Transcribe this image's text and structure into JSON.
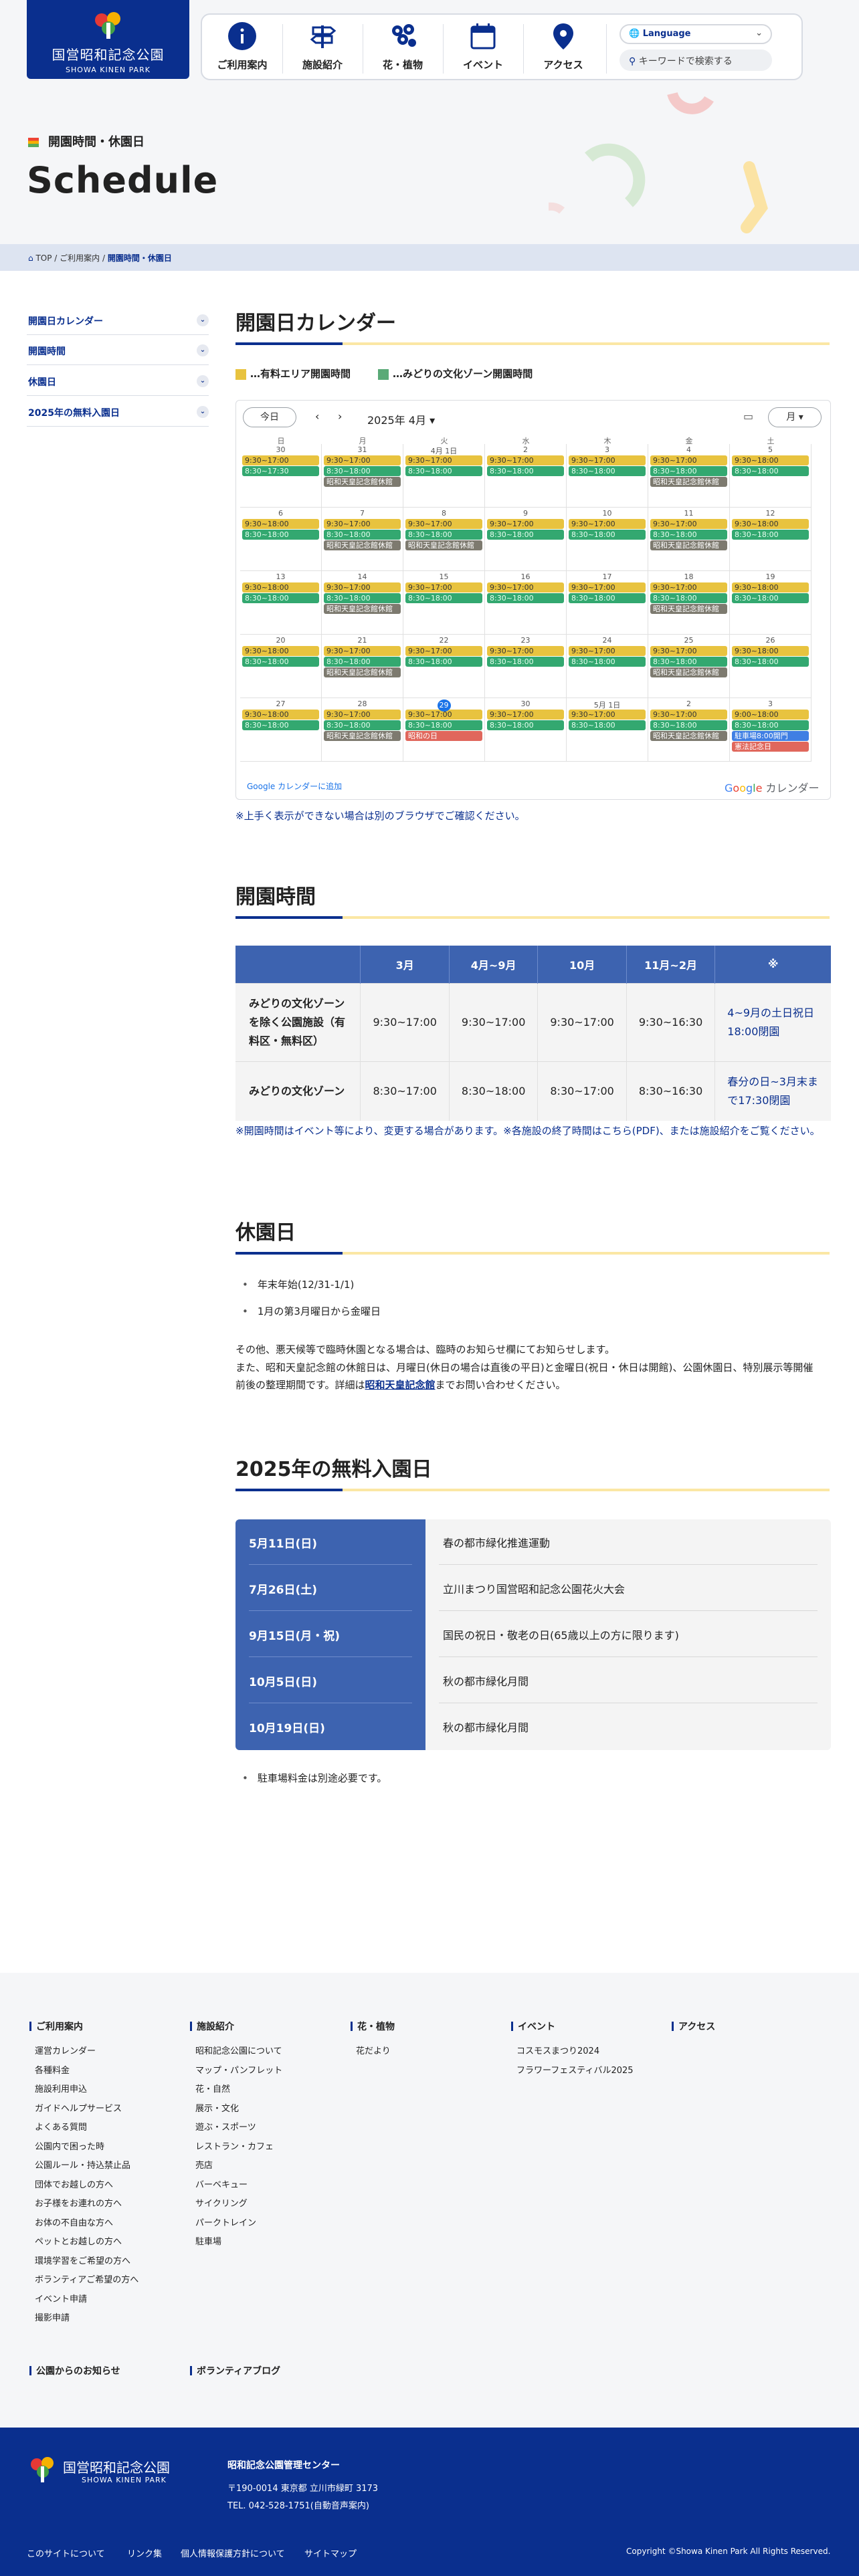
{
  "header": {
    "logo_ja": "国営昭和記念公園",
    "logo_en": "SHOWA KINEN PARK",
    "nav": [
      {
        "label": "ご利用案内",
        "icon": "info-icon"
      },
      {
        "label": "施設紹介",
        "icon": "signpost-icon"
      },
      {
        "label": "花・植物",
        "icon": "flower-icon"
      },
      {
        "label": "イベント",
        "icon": "calendar-icon"
      },
      {
        "label": "アクセス",
        "icon": "map-pin-icon"
      }
    ],
    "language": "Language",
    "search_placeholder": "キーワードで検索する"
  },
  "hero": {
    "subtitle": "開園時間・休園日",
    "title": "Schedule"
  },
  "breadcrumb": [
    "TOP",
    "ご利用案内",
    "開園時間・休園日"
  ],
  "sidebar": [
    "開園日カレンダー",
    "開園時間",
    "休園日",
    "2025年の無料入園日"
  ],
  "calendar": {
    "heading": "開園日カレンダー",
    "legend_yellow": "…有料エリア開園時間",
    "legend_green": "…みどりの文化ゾーン開園時間",
    "today_btn": "今日",
    "month_label": "2025年 4月",
    "view_btn": "月",
    "days": [
      "日",
      "月",
      "火",
      "水",
      "木",
      "金",
      "土"
    ],
    "add_link": "Google カレンダーに追加",
    "google_text": "カレンダー",
    "weeks": [
      [
        {
          "d": "30",
          "ev": [
            [
              "y",
              "9:30~17:00"
            ],
            [
              "g",
              "8:30~17:30"
            ]
          ]
        },
        {
          "d": "31",
          "ev": [
            [
              "y",
              "9:30~17:00"
            ],
            [
              "g",
              "8:30~18:00"
            ],
            [
              "k",
              "昭和天皇記念館休館"
            ]
          ]
        },
        {
          "d": "4月 1日",
          "ev": [
            [
              "y",
              "9:30~17:00"
            ],
            [
              "g",
              "8:30~18:00"
            ]
          ]
        },
        {
          "d": "2",
          "ev": [
            [
              "y",
              "9:30~17:00"
            ],
            [
              "g",
              "8:30~18:00"
            ]
          ]
        },
        {
          "d": "3",
          "ev": [
            [
              "y",
              "9:30~17:00"
            ],
            [
              "g",
              "8:30~18:00"
            ]
          ]
        },
        {
          "d": "4",
          "ev": [
            [
              "y",
              "9:30~17:00"
            ],
            [
              "g",
              "8:30~18:00"
            ],
            [
              "k",
              "昭和天皇記念館休館"
            ]
          ]
        },
        {
          "d": "5",
          "ev": [
            [
              "y",
              "9:30~18:00"
            ],
            [
              "g",
              "8:30~18:00"
            ]
          ]
        }
      ],
      [
        {
          "d": "6",
          "ev": [
            [
              "y",
              "9:30~18:00"
            ],
            [
              "g",
              "8:30~18:00"
            ]
          ]
        },
        {
          "d": "7",
          "ev": [
            [
              "y",
              "9:30~17:00"
            ],
            [
              "g",
              "8:30~18:00"
            ],
            [
              "k",
              "昭和天皇記念館休館"
            ]
          ]
        },
        {
          "d": "8",
          "ev": [
            [
              "y",
              "9:30~17:00"
            ],
            [
              "g",
              "8:30~18:00"
            ],
            [
              "k",
              "昭和天皇記念館休館"
            ]
          ]
        },
        {
          "d": "9",
          "ev": [
            [
              "y",
              "9:30~17:00"
            ],
            [
              "g",
              "8:30~18:00"
            ]
          ]
        },
        {
          "d": "10",
          "ev": [
            [
              "y",
              "9:30~17:00"
            ],
            [
              "g",
              "8:30~18:00"
            ]
          ]
        },
        {
          "d": "11",
          "ev": [
            [
              "y",
              "9:30~17:00"
            ],
            [
              "g",
              "8:30~18:00"
            ],
            [
              "k",
              "昭和天皇記念館休館"
            ]
          ]
        },
        {
          "d": "12",
          "ev": [
            [
              "y",
              "9:30~18:00"
            ],
            [
              "g",
              "8:30~18:00"
            ]
          ]
        }
      ],
      [
        {
          "d": "13",
          "ev": [
            [
              "y",
              "9:30~18:00"
            ],
            [
              "g",
              "8:30~18:00"
            ]
          ]
        },
        {
          "d": "14",
          "ev": [
            [
              "y",
              "9:30~17:00"
            ],
            [
              "g",
              "8:30~18:00"
            ],
            [
              "k",
              "昭和天皇記念館休館"
            ]
          ]
        },
        {
          "d": "15",
          "ev": [
            [
              "y",
              "9:30~17:00"
            ],
            [
              "g",
              "8:30~18:00"
            ]
          ]
        },
        {
          "d": "16",
          "ev": [
            [
              "y",
              "9:30~17:00"
            ],
            [
              "g",
              "8:30~18:00"
            ]
          ]
        },
        {
          "d": "17",
          "ev": [
            [
              "y",
              "9:30~17:00"
            ],
            [
              "g",
              "8:30~18:00"
            ]
          ]
        },
        {
          "d": "18",
          "ev": [
            [
              "y",
              "9:30~17:00"
            ],
            [
              "g",
              "8:30~18:00"
            ],
            [
              "k",
              "昭和天皇記念館休館"
            ]
          ]
        },
        {
          "d": "19",
          "ev": [
            [
              "y",
              "9:30~18:00"
            ],
            [
              "g",
              "8:30~18:00"
            ]
          ]
        }
      ],
      [
        {
          "d": "20",
          "ev": [
            [
              "y",
              "9:30~18:00"
            ],
            [
              "g",
              "8:30~18:00"
            ]
          ]
        },
        {
          "d": "21",
          "ev": [
            [
              "y",
              "9:30~17:00"
            ],
            [
              "g",
              "8:30~18:00"
            ],
            [
              "k",
              "昭和天皇記念館休館"
            ]
          ]
        },
        {
          "d": "22",
          "ev": [
            [
              "y",
              "9:30~17:00"
            ],
            [
              "g",
              "8:30~18:00"
            ]
          ]
        },
        {
          "d": "23",
          "ev": [
            [
              "y",
              "9:30~17:00"
            ],
            [
              "g",
              "8:30~18:00"
            ]
          ]
        },
        {
          "d": "24",
          "ev": [
            [
              "y",
              "9:30~17:00"
            ],
            [
              "g",
              "8:30~18:00"
            ]
          ]
        },
        {
          "d": "25",
          "ev": [
            [
              "y",
              "9:30~17:00"
            ],
            [
              "g",
              "8:30~18:00"
            ],
            [
              "k",
              "昭和天皇記念館休館"
            ]
          ]
        },
        {
          "d": "26",
          "ev": [
            [
              "y",
              "9:30~18:00"
            ],
            [
              "g",
              "8:30~18:00"
            ]
          ]
        }
      ],
      [
        {
          "d": "27",
          "ev": [
            [
              "y",
              "9:30~18:00"
            ],
            [
              "g",
              "8:30~18:00"
            ]
          ]
        },
        {
          "d": "28",
          "ev": [
            [
              "y",
              "9:30~17:00"
            ],
            [
              "g",
              "8:30~18:00"
            ],
            [
              "k",
              "昭和天皇記念館休館"
            ]
          ]
        },
        {
          "d": "29",
          "today": true,
          "ev": [
            [
              "y",
              "9:30~17:00"
            ],
            [
              "g",
              "8:30~18:00"
            ],
            [
              "r",
              "昭和の日"
            ]
          ]
        },
        {
          "d": "30",
          "ev": [
            [
              "y",
              "9:30~17:00"
            ],
            [
              "g",
              "8:30~18:00"
            ]
          ]
        },
        {
          "d": "5月 1日",
          "ev": [
            [
              "y",
              "9:30~17:00"
            ],
            [
              "g",
              "8:30~18:00"
            ]
          ]
        },
        {
          "d": "2",
          "ev": [
            [
              "y",
              "9:30~17:00"
            ],
            [
              "g",
              "8:30~18:00"
            ],
            [
              "k",
              "昭和天皇記念館休館"
            ]
          ]
        },
        {
          "d": "3",
          "ev": [
            [
              "y",
              "9:00~18:00"
            ],
            [
              "g",
              "8:30~18:00"
            ],
            [
              "b",
              "駐車場8:00開門"
            ],
            [
              "r",
              "憲法記念日"
            ]
          ]
        }
      ]
    ],
    "note": "※上手く表示ができない場合は別のブラウザでご確認ください。"
  },
  "hours": {
    "heading": "開園時間",
    "headers": [
      "",
      "3月",
      "4月~9月",
      "10月",
      "11月~2月",
      "※"
    ],
    "rows": [
      [
        "みどりの文化ゾーンを除く公園施設（有料区・無料区）",
        "9:30~17:00",
        "9:30~17:00",
        "9:30~17:00",
        "9:30~16:30",
        "4~9月の土日祝日18:00閉園"
      ],
      [
        "みどりの文化ゾーン",
        "8:30~17:00",
        "8:30~18:00",
        "8:30~17:00",
        "8:30~16:30",
        "春分の日~3月末まで17:30閉園"
      ]
    ],
    "note": "※開園時間はイベント等により、変更する場合があります。※各施設の終了時間はこちら(PDF)、または施設紹介をご覧ください。"
  },
  "closed": {
    "heading": "休園日",
    "items": [
      "年末年始(12/31-1/1)",
      "1月の第3月曜日から金曜日"
    ],
    "p1": "その他、悪天候等で臨時休園となる場合は、臨時のお知らせ欄にてお知らせします。",
    "p2a": "また、昭和天皇記念館の休館日は、月曜日(休日の場合は直後の平日)と金曜日(祝日・休日は開館)、公園休園日、特別展示等開催",
    "p2b": "前後の整理期間です。詳細は",
    "p2link": "昭和天皇記念館",
    "p2c": "までお問い合わせください。"
  },
  "free": {
    "heading": "2025年の無料入園日",
    "rows": [
      [
        "5月11日(日)",
        "春の都市緑化推進運動"
      ],
      [
        "7月26日(土)",
        "立川まつり国営昭和記念公園花火大会"
      ],
      [
        "9月15日(月・祝)",
        "国民の祝日・敬老の日(65歳以上の方に限ります)"
      ],
      [
        "10月5日(日)",
        "秋の都市緑化月間"
      ],
      [
        "10月19日(日)",
        "秋の都市緑化月間"
      ]
    ],
    "note": "駐車場料金は別途必要です。"
  },
  "footer_nav": {
    "cols": [
      {
        "title": "ご利用案内",
        "items": [
          "運営カレンダー",
          "各種料金",
          "施設利用申込",
          "ガイドヘルプサービス",
          "よくある質問",
          "公園内で困った時",
          "公園ルール・持込禁止品",
          "団体でお越しの方へ",
          "お子様をお連れの方へ",
          "お体の不自由な方へ",
          "ペットとお越しの方へ",
          "環境学習をご希望の方へ",
          "ボランティアご希望の方へ",
          "イベント申請",
          "撮影申請"
        ]
      },
      {
        "title": "施設紹介",
        "items": [
          "昭和記念公園について",
          "マップ・パンフレット",
          "花・自然",
          "展示・文化",
          "遊ぶ・スポーツ",
          "レストラン・カフェ",
          "売店",
          "バーベキュー",
          "サイクリング",
          "パークトレイン",
          "駐車場"
        ]
      },
      {
        "title": "花・植物",
        "items": [
          "花だより"
        ]
      },
      {
        "title": "イベント",
        "items": [
          "コスモスまつり2024",
          "フラワーフェスティバル2025"
        ]
      },
      {
        "title": "アクセス",
        "items": []
      }
    ],
    "extra": [
      "公園からのお知らせ",
      "ボランティアブログ"
    ]
  },
  "footer": {
    "org": "昭和記念公園管理センター",
    "address": "〒190-0014 東京都 立川市緑町 3173",
    "tel": "TEL. 042-528-1751(自動音声案内)",
    "links": [
      "このサイトについて",
      "リンク集",
      "個人情報保護方針について",
      "サイトマップ"
    ],
    "copyright": "Copyright ©Showa Kinen Park All Rights Reserved."
  }
}
